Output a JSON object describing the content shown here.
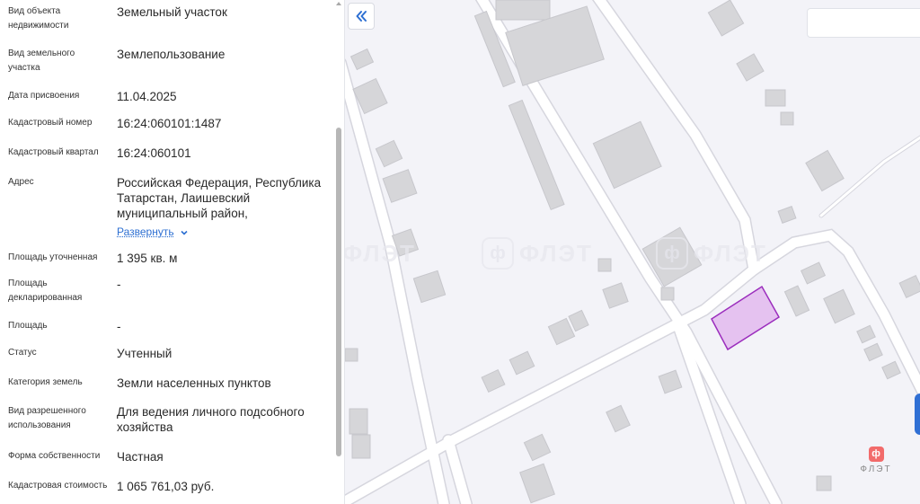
{
  "details": {
    "object_type": {
      "label": "Вид объекта недвижимости",
      "value": "Земельный участок"
    },
    "plot_type": {
      "label": "Вид земельного участка",
      "value": "Землепользование"
    },
    "assign_date": {
      "label": "Дата присвоения",
      "value": "11.04.2025"
    },
    "cadastral_number": {
      "label": "Кадастровый номер",
      "value": "16:24:060101:1487"
    },
    "cadastral_block": {
      "label": "Кадастровый квартал",
      "value": "16:24:060101"
    },
    "address": {
      "label": "Адрес",
      "value": "Российская Федерация, Республика Татарстан, Лаишевский муниципальный район,",
      "expand_label": "Развернуть"
    },
    "area_specified": {
      "label": "Площадь уточненная",
      "value": "1 395 кв. м"
    },
    "area_declared": {
      "label": "Площадь декларированная",
      "value": "-"
    },
    "area": {
      "label": "Площадь",
      "value": "-"
    },
    "status": {
      "label": "Статус",
      "value": "Учтенный"
    },
    "land_category": {
      "label": "Категория земель",
      "value": "Земли населенных пунктов"
    },
    "permitted_use": {
      "label": "Вид разрешенного использования",
      "value": "Для ведения личного подсобного хозяйства"
    },
    "ownership": {
      "label": "Форма собственности",
      "value": "Частная"
    },
    "cadastral_value": {
      "label": "Кадастровая стоимость",
      "value": "1 065 761,03 руб."
    }
  },
  "map": {
    "collapse_icon": "double-chevron-left-icon",
    "watermark": {
      "mark": "ф",
      "text": "ФЛЭТ"
    },
    "logo": {
      "mark": "ф",
      "text": "ФЛЭТ"
    },
    "highlight_color": "#e5c2f0",
    "highlight_stroke": "#9b2dbd"
  }
}
